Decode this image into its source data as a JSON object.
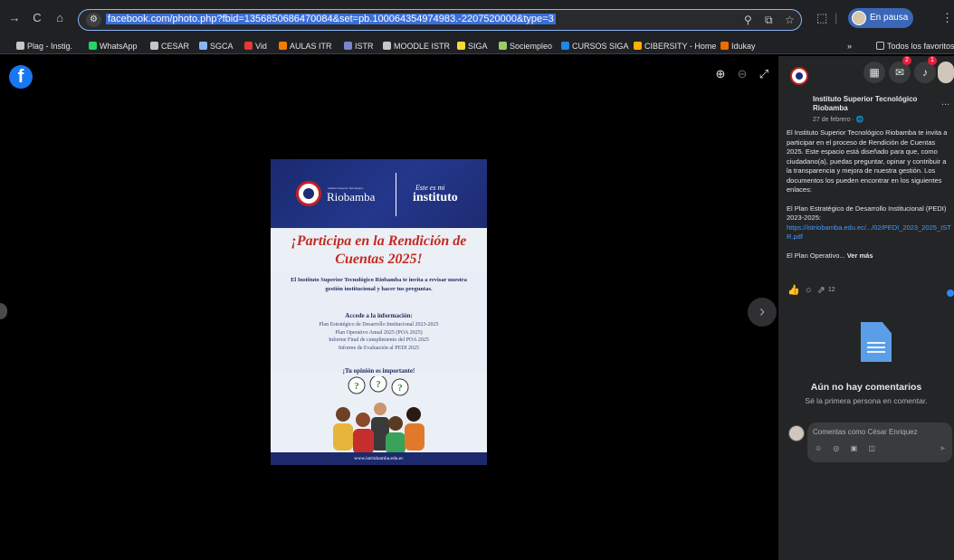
{
  "browser": {
    "back_icon": "→",
    "reload_icon": "C",
    "home_icon": "⌂",
    "url": "facebook.com/photo.php?fbid=1356850686470084&set=pb.100064354974983.-2207520000&type=3",
    "profile_status": "En pausa"
  },
  "bookmarks": {
    "items": [
      {
        "label": "Plag - Instig.",
        "color": "#c4c7c5"
      },
      {
        "label": "WhatsApp",
        "color": "#25d366"
      },
      {
        "label": "CESAR",
        "color": "#c4c7c5"
      },
      {
        "label": "SGCA",
        "color": "#8ab4f8"
      },
      {
        "label": "Vid",
        "color": "#e53935"
      },
      {
        "label": "AULAS ITR",
        "color": "#f57c00"
      },
      {
        "label": "ISTR",
        "color": "#7986cb"
      },
      {
        "label": "MOODLE ISTR",
        "color": "#c4c7c5"
      },
      {
        "label": "SIGA",
        "color": "#fdd835"
      },
      {
        "label": "Sociempleo",
        "color": "#9ccc65"
      },
      {
        "label": "CURSOS SIGA",
        "color": "#1e88e5"
      },
      {
        "label": "CIBERSITY - Home",
        "color": "#ffb300"
      },
      {
        "label": "Idukay",
        "color": "#ef6c00"
      }
    ],
    "overflow_label": "»",
    "all_bookmarks_label": "Todos los favoritos"
  },
  "viewer": {
    "fb_logo_letter": "f",
    "zoom_in_icon": "⊕",
    "zoom_out_icon": "⊖",
    "fullscreen_icon": "⤢",
    "next_icon": "›"
  },
  "poster": {
    "institute_small": "Instituto Superior Tecnológico",
    "institute_name": "Riobamba",
    "slogan_line1": "Este es mi",
    "slogan_line2": "instituto",
    "title_line1": "¡Participa en la Rendición de",
    "title_line2": "Cuentas 2025!",
    "intro": "El Instituto Superior Tecnológico Riobamba te invita a revisar nuestra gestión institucional y hacer tus preguntas.",
    "access_heading": "Accede a la información:",
    "access_items": [
      "Plan Estratégico de Desarrollo Institucional 2023-2025",
      "Plan Operativo Anual 2025 (POA 2025)",
      "Informe Final de cumplimiento del POA 2025",
      "Informe de Evaluación al PEDI 2025"
    ],
    "opinion": "¡Tu opinión es importante!",
    "website": "www.istriobamba.edu.ec"
  },
  "sidepanel": {
    "menu_icon": "▦",
    "messenger_badge": "2",
    "notif_badge": "1",
    "page_name": "Instituto Superior Tecnológico Riobamba",
    "post_date": "27 de febrero · 🌐",
    "more_label": "...",
    "post_intro": "El Instituto Superior Tecnológico Riobamba te invita a participar en el proceso de Rendición de Cuentas 2025. Este espacio está diseñado para que, como ciudadano(a), puedas preguntar, opinar y contribuir a la transparencia y mejora de nuestra gestión. Los documentos los pueden encontrar en los siguientes enlaces:",
    "pedi_label": "El Plan Estratégico de Desarrollo Institucional (PEDI) 2023-2025:",
    "pedi_link": "https://istriobamba.edu.ec/.../02/PEDI_2023_2025_ISTR.pdf",
    "operativo_label": "El Plan Operativo...",
    "see_more": "Ver más",
    "like_icon": "👍",
    "comment_icon": "○",
    "share_icon": "⇗",
    "share_count": "12",
    "no_comments_title": "Aún no hay comentarios",
    "no_comments_sub": "Sé la primera persona en comentar.",
    "comment_placeholder": "Comentas como César Enriquez",
    "comment_tools": "☺ ◎ ▣ ◫",
    "send_icon": "➤"
  }
}
